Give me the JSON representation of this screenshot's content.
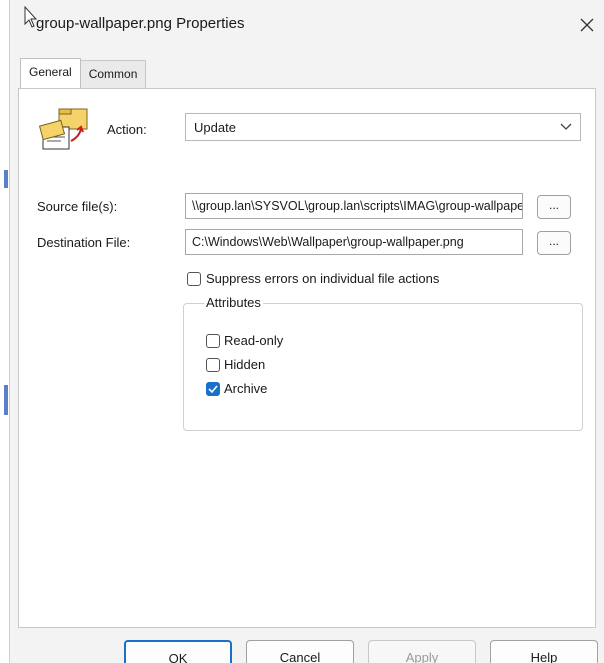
{
  "window": {
    "title": "group-wallpaper.png Properties",
    "close_glyph": "✕"
  },
  "tabs": [
    {
      "label": "General",
      "active": true
    },
    {
      "label": "Common",
      "active": false
    }
  ],
  "general": {
    "action_label": "Action:",
    "action_value": "Update",
    "source_label": "Source file(s):",
    "source_value": "\\\\group.lan\\SYSVOL\\group.lan\\scripts\\IMAG\\group-wallpaper.png",
    "destination_label": "Destination File:",
    "destination_value": "C:\\Windows\\Web\\Wallpaper\\group-wallpaper.png",
    "browse_label": "...",
    "suppress_label": "Suppress errors on individual file actions",
    "suppress_checked": false,
    "attributes": {
      "title": "Attributes",
      "read_only_label": "Read-only",
      "read_only_checked": false,
      "hidden_label": "Hidden",
      "hidden_checked": false,
      "archive_label": "Archive",
      "archive_checked": true
    }
  },
  "buttons": {
    "ok": "OK",
    "cancel": "Cancel",
    "apply": "Apply",
    "help": "Help"
  },
  "colors": {
    "accent": "#1a6fc9"
  },
  "icons": {
    "action": "folder-copy-icon",
    "close": "close-icon",
    "combo": "chevron-down-icon",
    "cursor": "mouse-cursor-icon",
    "check": "checkmark-icon"
  }
}
